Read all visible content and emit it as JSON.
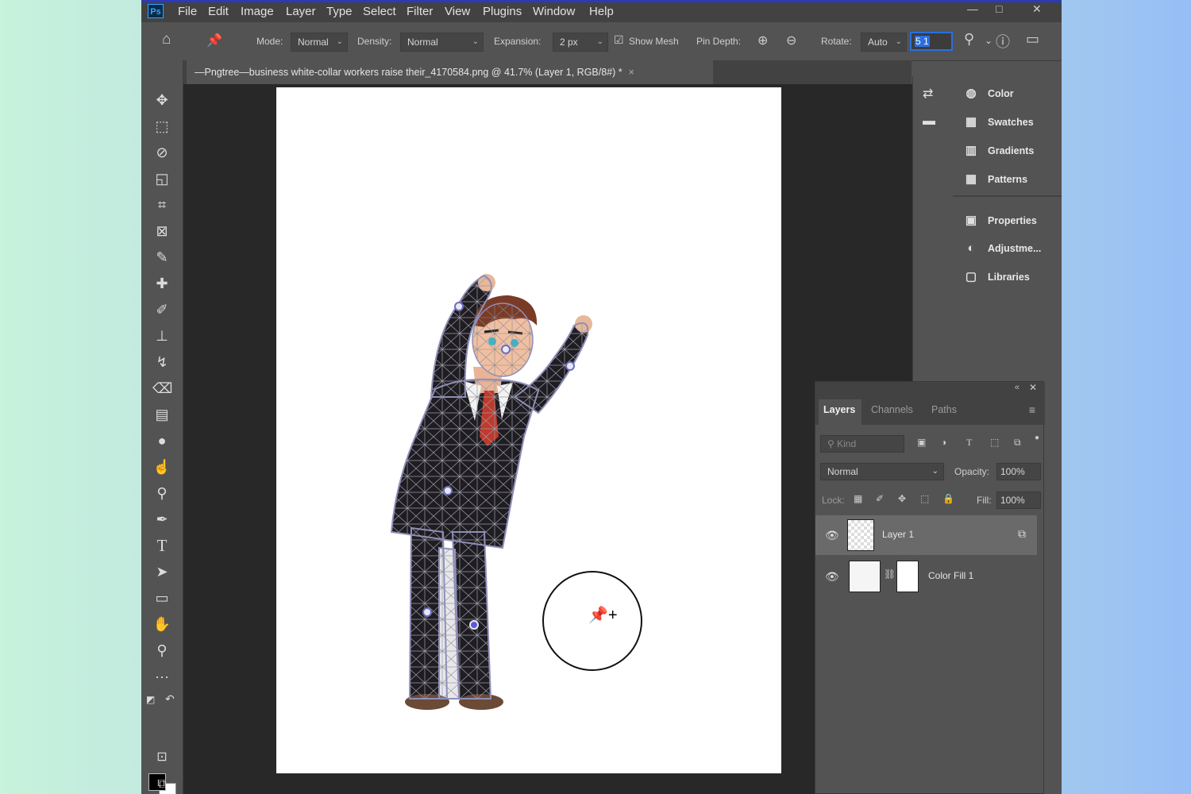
{
  "app": {
    "logo": "Ps"
  },
  "menu": [
    "File",
    "Edit",
    "Image",
    "Layer",
    "Type",
    "Select",
    "Filter",
    "View",
    "Plugins",
    "Window",
    "Help"
  ],
  "window_controls": {
    "minimize": "—",
    "restore": "□",
    "close": "✕"
  },
  "options": {
    "mode_label": "Mode:",
    "mode_value": "Normal",
    "density_label": "Density:",
    "density_value": "Normal",
    "expansion_label": "Expansion:",
    "expansion_value": "2 px",
    "show_mesh_label": "Show Mesh",
    "show_mesh_checked": true,
    "pin_depth_label": "Pin Depth:",
    "rotate_label": "Rotate:",
    "rotate_value": "Auto",
    "rotate_degrees": "5 1"
  },
  "document_tab": {
    "title": "—Pngtree—business white-collar workers raise their_4170584.png @ 41.7% (Layer 1, RGB/8#) *",
    "close": "×"
  },
  "tools": [
    "move-icon",
    "marquee-icon",
    "quick-select-icon",
    "object-select-icon",
    "crop-icon",
    "frame-icon",
    "eyedropper-icon",
    "healing-icon",
    "brush-icon",
    "stamp-icon",
    "history-brush-icon",
    "eraser-icon",
    "gradient-icon",
    "blur-icon",
    "smudge-icon",
    "dodge-icon",
    "pen-icon",
    "type-icon",
    "path-select-icon",
    "rectangle-icon",
    "hand-icon",
    "zoom-icon",
    "more-tools-icon"
  ],
  "right_panels": [
    {
      "label": "Color",
      "icon": "palette-icon"
    },
    {
      "label": "Swatches",
      "icon": "grid-icon"
    },
    {
      "label": "Gradients",
      "icon": "gradient-icon"
    },
    {
      "label": "Patterns",
      "icon": "pattern-icon"
    },
    {
      "label": "Properties",
      "icon": "properties-icon"
    },
    {
      "label": "Adjustme...",
      "icon": "adjustments-icon"
    },
    {
      "label": "Libraries",
      "icon": "libraries-icon"
    }
  ],
  "layers_panel": {
    "tabs": [
      "Layers",
      "Channels",
      "Paths"
    ],
    "active_tab": "Layers",
    "filter_placeholder": "Kind",
    "blend_mode": "Normal",
    "opacity_label": "Opacity:",
    "opacity_value": "100%",
    "lock_label": "Lock:",
    "fill_label": "Fill:",
    "fill_value": "100%",
    "layers": [
      {
        "name": "Layer 1",
        "visible": true,
        "selected": true
      },
      {
        "name": "Color Fill 1",
        "visible": true,
        "selected": false
      }
    ]
  },
  "colors": {
    "foreground": "#000000",
    "background": "#ffffff",
    "accent": "#2a6fe0",
    "tie": "#c0392b"
  }
}
